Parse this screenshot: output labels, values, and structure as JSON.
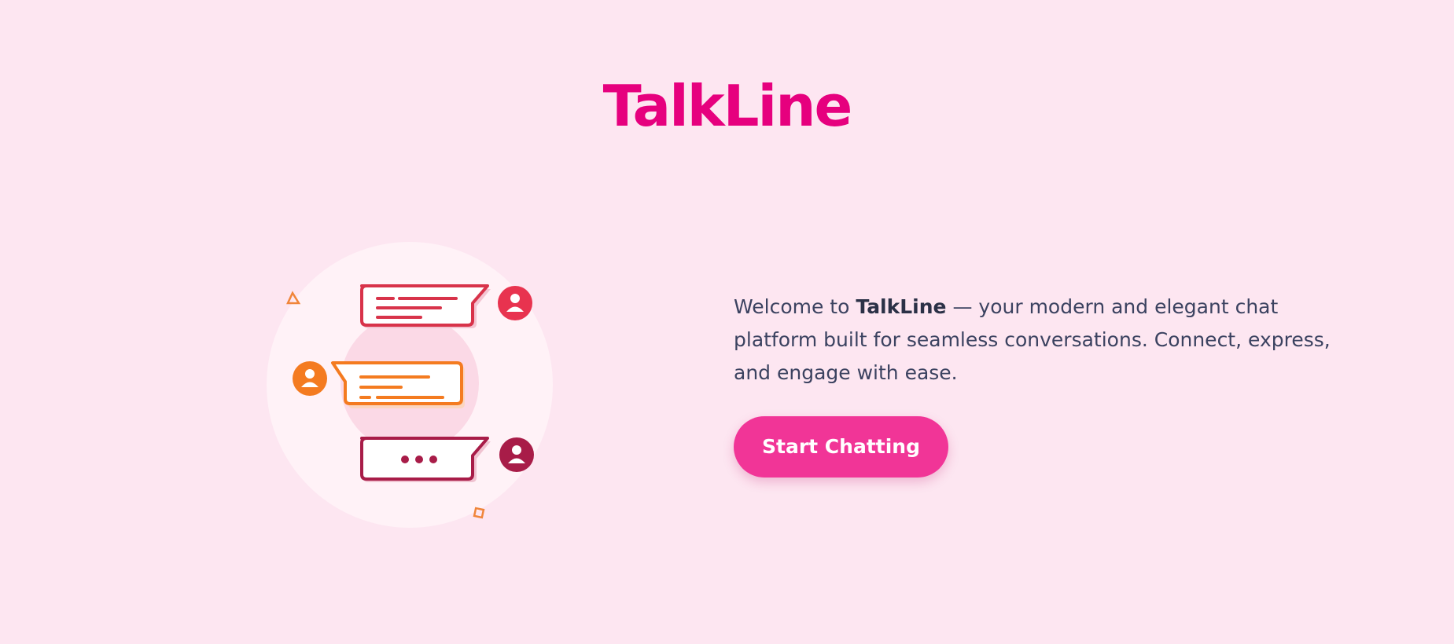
{
  "app": {
    "title": "TalkLine"
  },
  "hero": {
    "tagline_prefix": "Welcome to",
    "tagline_brand": "TalkLine",
    "tagline_suffix": "— your modern and elegant chat platform built for seamless conversations. Connect, express, and engage with ease.",
    "cta_label": "Start Chatting"
  },
  "illustration": {
    "icons": [
      "chat-bubble-icon",
      "user-avatar-icon",
      "typing-dots-icon",
      "triangle-icon",
      "square-icon"
    ]
  },
  "colors": {
    "background": "#fde6f1",
    "title": "#e6007e",
    "cta": "#f13597",
    "bubble_red": "#d8334a",
    "bubble_orange": "#f47b20",
    "bubble_maroon": "#a81c48"
  }
}
